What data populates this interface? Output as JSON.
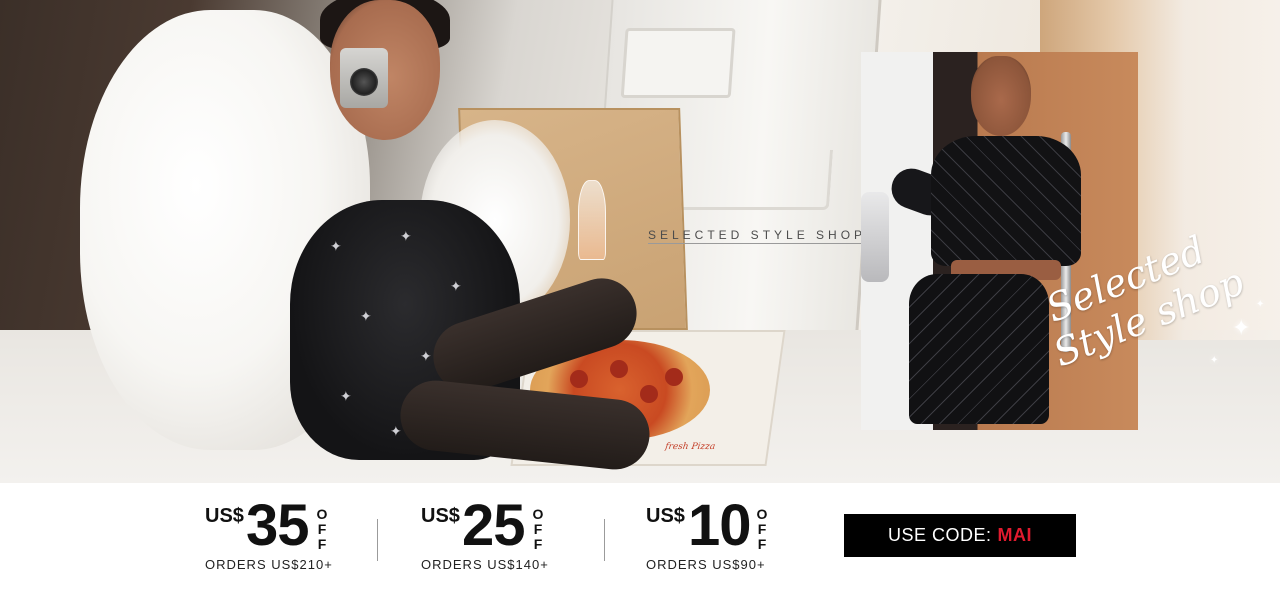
{
  "hero": {
    "title": "SELECTED STYLE SHOP",
    "script_title_line1": "Selected",
    "script_title_line2": "Style shop",
    "pizza_box_text": "fresh Pizza"
  },
  "offers": [
    {
      "currency": "US$",
      "amount": "35",
      "off": [
        "O",
        "F",
        "F"
      ],
      "condition": "ORDERS US$210+"
    },
    {
      "currency": "US$",
      "amount": "25",
      "off": [
        "O",
        "F",
        "F"
      ],
      "condition": "ORDERS US$140+"
    },
    {
      "currency": "US$",
      "amount": "10",
      "off": [
        "O",
        "F",
        "F"
      ],
      "condition": "ORDERS US$90+"
    }
  ],
  "promo_code": {
    "label": "USE CODE:",
    "value": "MAI"
  },
  "colors": {
    "code_box_background": "#000000",
    "code_value": "#e01a2e",
    "text": "#111111"
  },
  "icons": {
    "sparkle": "sparkle-icon"
  }
}
